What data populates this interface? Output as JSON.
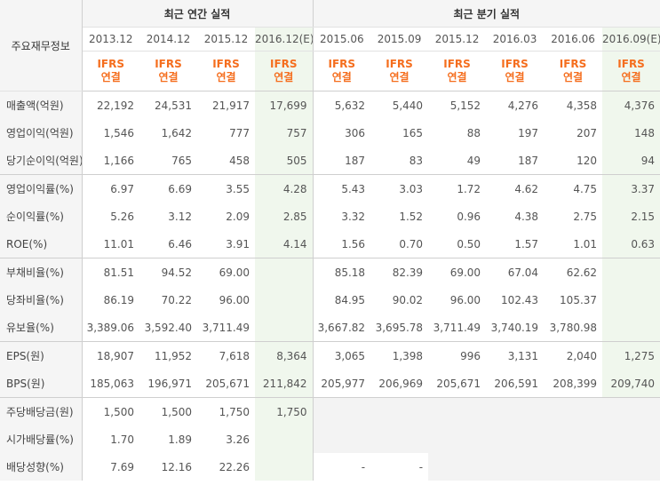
{
  "header": {
    "corner": "주요재무정보",
    "annual_title": "최근 연간 실적",
    "quarterly_title": "최근 분기 실적",
    "periods": [
      "2013.12",
      "2014.12",
      "2015.12",
      "2016.12(E)",
      "2015.06",
      "2015.09",
      "2015.12",
      "2016.03",
      "2016.06",
      "2016.09(E)"
    ],
    "basis_top": "IFRS",
    "basis_bottom": "연결"
  },
  "rows": [
    {
      "label": "매출액(억원)",
      "values": [
        "22,192",
        "24,531",
        "21,917",
        "17,699",
        "5,632",
        "5,440",
        "5,152",
        "4,276",
        "4,358",
        "4,376"
      ]
    },
    {
      "label": "영업이익(억원)",
      "values": [
        "1,546",
        "1,642",
        "777",
        "757",
        "306",
        "165",
        "88",
        "197",
        "207",
        "148"
      ]
    },
    {
      "label": "당기순이익(억원)",
      "values": [
        "1,166",
        "765",
        "458",
        "505",
        "187",
        "83",
        "49",
        "187",
        "120",
        "94"
      ]
    },
    {
      "label": "영업이익률(%)",
      "values": [
        "6.97",
        "6.69",
        "3.55",
        "4.28",
        "5.43",
        "3.03",
        "1.72",
        "4.62",
        "4.75",
        "3.37"
      ]
    },
    {
      "label": "순이익률(%)",
      "values": [
        "5.26",
        "3.12",
        "2.09",
        "2.85",
        "3.32",
        "1.52",
        "0.96",
        "4.38",
        "2.75",
        "2.15"
      ]
    },
    {
      "label": "ROE(%)",
      "values": [
        "11.01",
        "6.46",
        "3.91",
        "4.14",
        "1.56",
        "0.70",
        "0.50",
        "1.57",
        "1.01",
        "0.63"
      ]
    },
    {
      "label": "부채비율(%)",
      "values": [
        "81.51",
        "94.52",
        "69.00",
        "",
        "85.18",
        "82.39",
        "69.00",
        "67.04",
        "62.62",
        ""
      ]
    },
    {
      "label": "당좌비율(%)",
      "values": [
        "86.19",
        "70.22",
        "96.00",
        "",
        "84.95",
        "90.02",
        "96.00",
        "102.43",
        "105.37",
        ""
      ]
    },
    {
      "label": "유보율(%)",
      "values": [
        "3,389.06",
        "3,592.40",
        "3,711.49",
        "",
        "3,667.82",
        "3,695.78",
        "3,711.49",
        "3,740.19",
        "3,780.98",
        ""
      ]
    },
    {
      "label": "EPS(원)",
      "values": [
        "18,907",
        "11,952",
        "7,618",
        "8,364",
        "3,065",
        "1,398",
        "996",
        "3,131",
        "2,040",
        "1,275"
      ]
    },
    {
      "label": "BPS(원)",
      "values": [
        "185,063",
        "196,971",
        "205,671",
        "211,842",
        "205,977",
        "206,969",
        "205,671",
        "206,591",
        "208,399",
        "209,740"
      ]
    },
    {
      "label": "주당배당금(원)",
      "values": [
        "1,500",
        "1,500",
        "1,750",
        "1,750",
        "",
        "",
        "",
        "",
        "",
        ""
      ]
    },
    {
      "label": "시가배당률(%)",
      "values": [
        "1.70",
        "1.89",
        "3.26",
        "",
        "",
        "",
        "",
        "",
        "",
        ""
      ]
    },
    {
      "label": "배당성향(%)",
      "values": [
        "7.69",
        "12.16",
        "22.26",
        "",
        "-",
        "-",
        "",
        "",
        "",
        ""
      ]
    }
  ]
}
